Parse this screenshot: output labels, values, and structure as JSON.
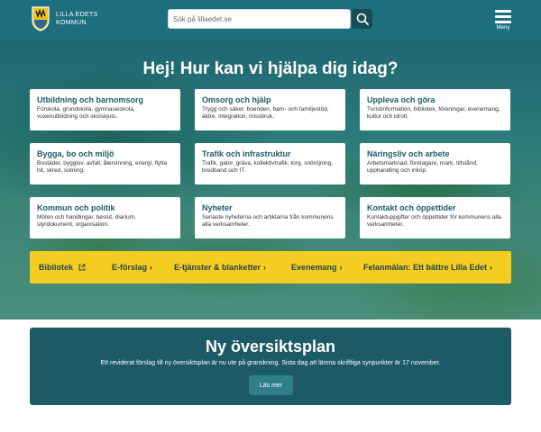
{
  "header": {
    "logo_line1": "LILLA EDETS",
    "logo_line2": "KOMMUN",
    "search_placeholder": "Sök på lillaedet.se",
    "menu_label": "Meny"
  },
  "hero": {
    "title": "Hej! Hur kan vi hjälpa dig idag?",
    "cards": [
      {
        "title": "Utbildning och barnomsorg",
        "desc": "Förskola, grundskola, gymnasieskola, vuxenutbildning och skolskjuts."
      },
      {
        "title": "Omsorg och hjälp",
        "desc": "Trygg och säker, boenden, barn- och familjestöd, äldre, integration, missbruk."
      },
      {
        "title": "Uppleva och göra",
        "desc": "Turistinformation, bibliotek, föreningar, evenemang, kultur och idrott."
      },
      {
        "title": "Bygga, bo och miljö",
        "desc": "Bostäder, bygglov, avfall, återvinning, energi, flytta hit, skred, sotning."
      },
      {
        "title": "Trafik och infrastruktur",
        "desc": "Trafik, gator, gräva, kollektivtrafik, torg, snöröjning, bredband och IT."
      },
      {
        "title": "Näringsliv och arbete",
        "desc": "Arbetsmarknad, företagare, mark, tillstånd, upphandling och inköp."
      },
      {
        "title": "Kommun och politik",
        "desc": "Möten och handlingar, beslut, diarium, styrdokument, organisation."
      },
      {
        "title": "Nyheter",
        "desc": "Senaste nyheterna och artiklarna från kommunens alla verksamheter."
      },
      {
        "title": "Kontakt och öppettider",
        "desc": "Kontaktuppgifter och öppettider för kommunens alla verksamheter."
      }
    ],
    "quick_links": [
      {
        "label": "Bibliotek",
        "icon": "external-link-icon"
      },
      {
        "label": "E-förslag",
        "icon": "chevron-right-icon"
      },
      {
        "label": "E-tjänster & blanketter",
        "icon": "chevron-right-icon"
      },
      {
        "label": "Evenemang",
        "icon": "chevron-right-icon"
      },
      {
        "label": "Felanmälan: Ett bättre Lilla Edet",
        "icon": "chevron-right-icon"
      }
    ]
  },
  "announcement": {
    "title": "Ny översiktsplan",
    "text": "Ett reviderat förslag till ny översiktsplan är nu ute på granskning. Sista dag att lämna skriftliga synpunkter är 17 november.",
    "button": "Läs mer"
  },
  "colors": {
    "header_bg": "#1d6f7d",
    "card_title": "#1b5a6b",
    "quickbar_bg": "#f5cc1f",
    "announce_bg": "#1b5a66",
    "button_bg": "#2f7f8b"
  }
}
